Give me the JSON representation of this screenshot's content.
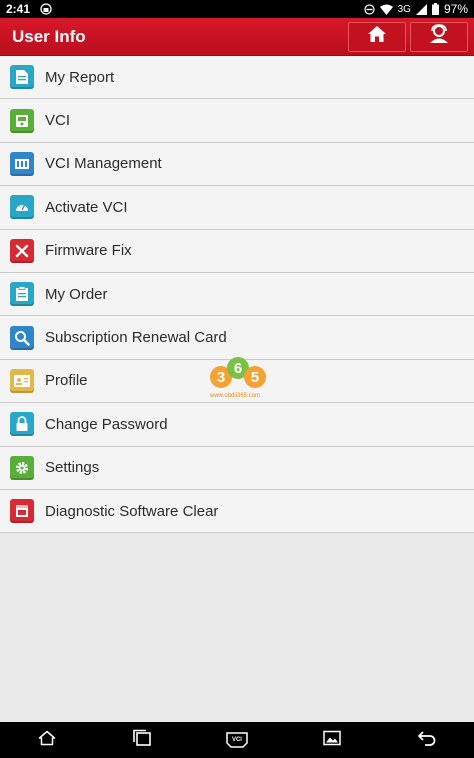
{
  "status_bar": {
    "time": "2:41",
    "network": "3G",
    "battery": "97%"
  },
  "header": {
    "title": "User Info",
    "home_icon": "home-icon",
    "user_icon": "user-support-icon"
  },
  "menu": [
    {
      "label": "My Report",
      "icon": "report-icon",
      "color": "#2aa6c6"
    },
    {
      "label": "VCI",
      "icon": "vci-icon",
      "color": "#5aae3a"
    },
    {
      "label": "VCI Management",
      "icon": "vci-management-icon",
      "color": "#2f86c8"
    },
    {
      "label": "Activate VCI",
      "icon": "activate-vci-icon",
      "color": "#2aa6c6"
    },
    {
      "label": "Firmware Fix",
      "icon": "firmware-fix-icon",
      "color": "#d62a35"
    },
    {
      "label": "My Order",
      "icon": "order-icon",
      "color": "#2aa6c6"
    },
    {
      "label": "Subscription Renewal Card",
      "icon": "search-icon",
      "color": "#2f86c8"
    },
    {
      "label": "Profile",
      "icon": "profile-icon",
      "color": "#e3b84a"
    },
    {
      "label": "Change Password",
      "icon": "lock-icon",
      "color": "#2aa6c6"
    },
    {
      "label": "Settings",
      "icon": "gear-icon",
      "color": "#5aae3a"
    },
    {
      "label": "Diagnostic Software Clear",
      "icon": "clear-icon",
      "color": "#d62a35"
    }
  ],
  "watermark": {
    "logo": "365",
    "url": "www.obdii365.com"
  },
  "nav_bar": {
    "vci_label": "VCI"
  }
}
